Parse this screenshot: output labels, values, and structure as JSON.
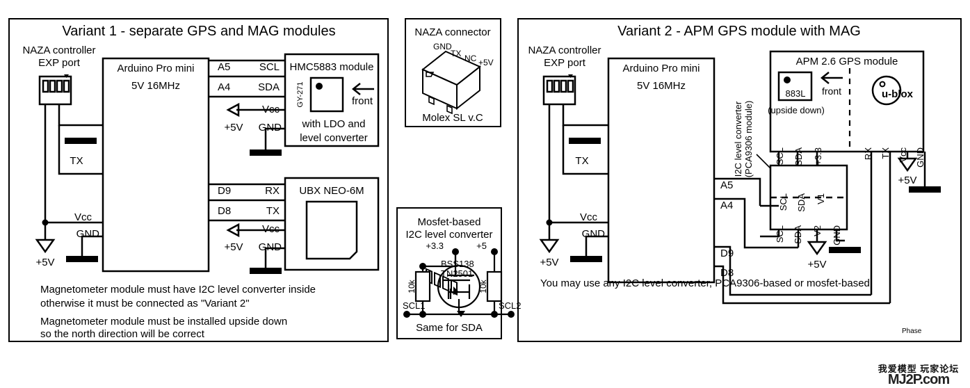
{
  "panels": {
    "variant1": {
      "title": "Variant 1 - separate GPS and MAG modules",
      "naza": {
        "line1": "NAZA controller",
        "line2": "EXP port"
      },
      "arduino": {
        "line1": "Arduino Pro mini",
        "line2": "5V 16MHz"
      },
      "mcu_pins": {
        "a5": "A5",
        "a4": "A4",
        "d9": "D9",
        "d8": "D8"
      },
      "arduino_side_labels": {
        "tx": "TX",
        "vcc": "Vcc",
        "gnd": "GND"
      },
      "power_label": "+5V",
      "mag": {
        "title": "HMC5883 module",
        "chip_label": "GY-271",
        "front": "front",
        "note1": "with LDO and",
        "note2": "level converter",
        "pins": {
          "scl": "SCL",
          "sda": "SDA",
          "vcc": "Vcc",
          "gnd": "GND"
        }
      },
      "gps": {
        "title": "UBX NEO-6M",
        "pins": {
          "rx": "RX",
          "tx": "TX",
          "vcc": "Vcc",
          "gnd": "GND"
        }
      },
      "notes": [
        "Magnetometer module must have I2C level converter inside",
        "otherwise it must be connected as \"Variant 2\"",
        "Magnetometer module must be installed upside down",
        "so the north direction will be correct"
      ]
    },
    "connector": {
      "title": "NAZA connector",
      "subtitle": "Molex SL v.C",
      "pin_labels": [
        "GND",
        "TX",
        "NC",
        "+5V"
      ]
    },
    "mosfet": {
      "title_line1": "Mosfet-based",
      "title_line2": "I2C level converter",
      "rail_low": "+3.3",
      "rail_high": "+5",
      "part1": "BSS138",
      "part2": "TN2501",
      "resistor": "10k",
      "left_term": "SCL1",
      "right_term": "SCL2",
      "footer": "Same for SDA"
    },
    "variant2": {
      "title": "Variant 2 - APM GPS module with MAG",
      "naza": {
        "line1": "NAZA controller",
        "line2": "EXP port"
      },
      "arduino": {
        "line1": "Arduino Pro mini",
        "line2": "5V 16MHz"
      },
      "mcu_pins": {
        "a5": "A5",
        "a4": "A4",
        "d9": "D9",
        "d8": "D8"
      },
      "arduino_side_labels": {
        "tx": "TX",
        "vcc": "Vcc",
        "gnd": "GND"
      },
      "power_label": "+5V",
      "converter": {
        "caption_line1": "I2C level converter",
        "caption_line2": "(PCA9306 module)",
        "top_pins": [
          "SCL",
          "SDA",
          "V1"
        ],
        "bottom_pins": [
          "SCL",
          "SDA",
          "V2",
          "GND"
        ]
      },
      "apm": {
        "title": "APM 2.6 GPS module",
        "mag_chip": "883L",
        "front": "front",
        "upside_down": "(upside down)",
        "ublox": "u-blox",
        "left_pins": [
          "SCL",
          "SDA",
          "+3.3"
        ],
        "right_pins": [
          "RX",
          "TX",
          "Vcc",
          "GND"
        ]
      },
      "note": "You may use any I2C level converter, PCA9306-based or mosfet-based",
      "corner_label": "Phase"
    }
  },
  "watermark": {
    "cn": "我爱模型 玩家论坛",
    "en": "MJ2P.com"
  },
  "colors": {
    "ink": "#000000",
    "paper": "#ffffff"
  }
}
